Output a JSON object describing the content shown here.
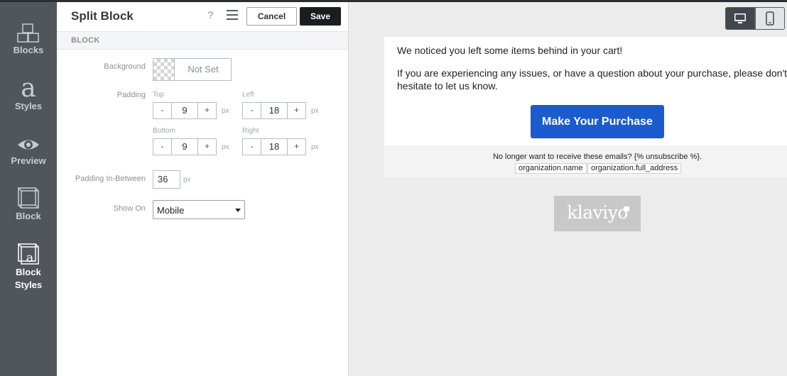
{
  "rail": {
    "items": [
      {
        "label": "Blocks",
        "icon": "blocks-icon"
      },
      {
        "label": "Styles",
        "icon": "styles-icon"
      },
      {
        "label": "Preview",
        "icon": "eye-icon"
      },
      {
        "label": "Block",
        "icon": "cube-icon"
      },
      {
        "label_line1": "Block",
        "label_line2": "Styles",
        "icon": "block-styles-icon"
      }
    ],
    "active": "Block Styles"
  },
  "panel": {
    "title": "Split Block",
    "help": "?",
    "cancel_label": "Cancel",
    "save_label": "Save",
    "section_label": "BLOCK",
    "background": {
      "label": "Background",
      "value": "Not Set"
    },
    "padding": {
      "label": "Padding",
      "unit": "px",
      "top": {
        "label": "Top",
        "value": "9"
      },
      "left": {
        "label": "Left",
        "value": "18"
      },
      "bottom": {
        "label": "Bottom",
        "value": "9"
      },
      "right": {
        "label": "Right",
        "value": "18"
      },
      "dec": "-",
      "inc": "+"
    },
    "padding_between": {
      "label": "Padding In-Between",
      "value": "36",
      "unit": "px"
    },
    "show_on": {
      "label": "Show On",
      "value": "Mobile"
    }
  },
  "preview": {
    "line1": "We noticed you left some items behind in your cart!",
    "line2a": "If you are experiencing any issues, or have a question about your purchase, please don't",
    "line2b": "hesitate to let us know.",
    "cta_label": "Make Your Purchase",
    "cta_color": "#1a5bcf",
    "unsubscribe": "No longer want to receive these emails? {% unsubscribe %}.",
    "tag_org_name": "organization.name",
    "tag_org_address": "organization.full_address",
    "logo_text": "klaviyo"
  }
}
